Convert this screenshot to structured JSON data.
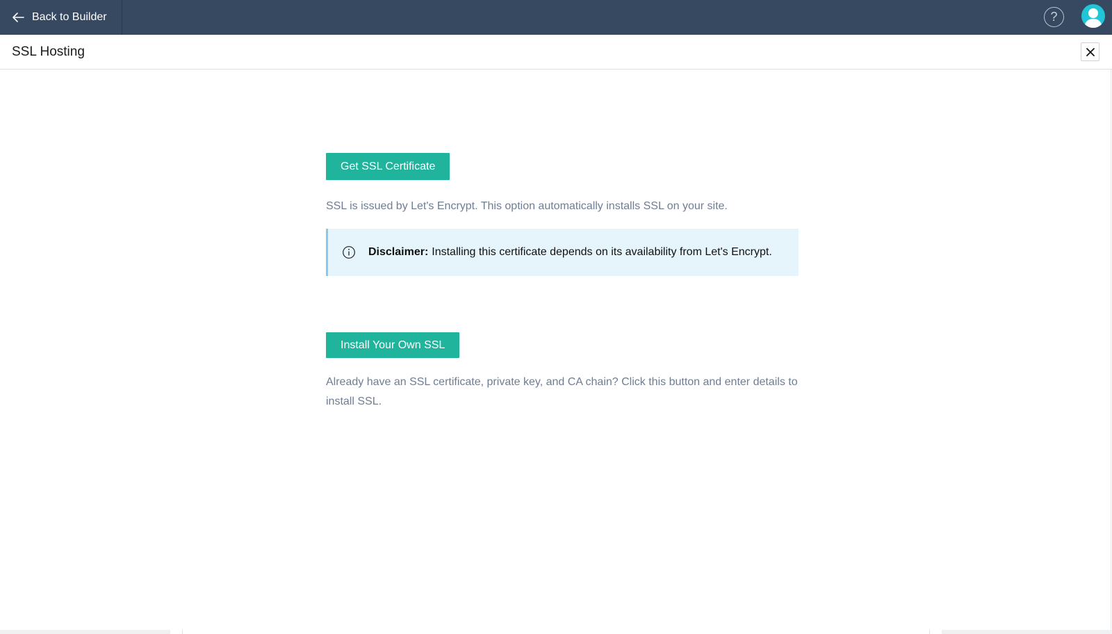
{
  "topbar": {
    "back_label": "Back to Builder",
    "help_symbol": "?",
    "colors": {
      "background": "#374861",
      "avatar": "#20c5d8"
    }
  },
  "page": {
    "title": "SSL Hosting"
  },
  "main": {
    "get_ssl_button": "Get SSL Certificate",
    "get_ssl_description": "SSL is issued by Let's Encrypt. This option automatically installs SSL on your site.",
    "disclaimer_label": "Disclaimer:",
    "disclaimer_text": "Installing this certificate depends on its availability from Let's Encrypt.",
    "install_own_button": "Install Your Own SSL",
    "install_own_description": "Already have an SSL certificate, private key, and CA chain? Click this button and enter details to install SSL.",
    "colors": {
      "button": "#1fb49b",
      "disclaimer_bg": "#e5f5fb",
      "disclaimer_border": "#7fcdea"
    }
  },
  "icons": [
    "arrow-left-icon",
    "help-icon",
    "user-avatar-icon",
    "close-icon",
    "info-icon"
  ]
}
